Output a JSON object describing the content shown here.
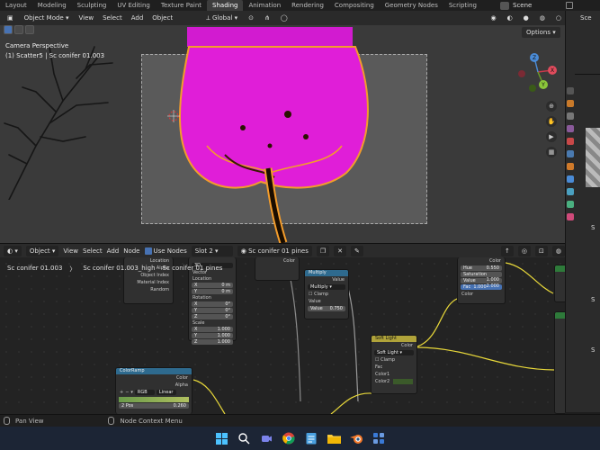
{
  "workspace_tabs": [
    "Layout",
    "Modeling",
    "Sculpting",
    "UV Editing",
    "Texture Paint",
    "Shading",
    "Animation",
    "Rendering",
    "Compositing",
    "Geometry Nodes",
    "Scripting"
  ],
  "active_tab_index": 5,
  "scene_name": "Scene",
  "viewport": {
    "mode": "Object Mode",
    "menus": [
      "View",
      "Select",
      "Add",
      "Object"
    ],
    "transform_orientation": "Global",
    "camera_label": "Camera Perspective",
    "object_label": "(1) Scatter5 | Sc conifer 01.003",
    "options_label": "Options",
    "gizmo_axes": [
      "X",
      "Y",
      "Z"
    ]
  },
  "right_panel": {
    "outliner_label": "Sce",
    "letters": [
      "S",
      "S",
      "S"
    ]
  },
  "node_editor": {
    "editor_type": "Object",
    "menus": [
      "View",
      "Select",
      "Add",
      "Node"
    ],
    "use_nodes_label": "Use Nodes",
    "slot": "Slot 2",
    "material": "Sc conifer 01 pines",
    "breadcrumb": [
      "Sc conifer 01.003",
      "Sc conifer 01.003_high",
      "Sc conifer 01 pines"
    ]
  },
  "nodes": {
    "object_info": {
      "outputs": [
        "Location",
        "Alpha",
        "Object Index",
        "Material Index",
        "Random"
      ]
    },
    "mapping": {
      "type": "3D",
      "vector_label": "Vector",
      "location_label": "Location",
      "rotation_label": "Rotation",
      "scale_label": "Scale",
      "location": [
        "0 m",
        "0 m",
        "0 m"
      ],
      "rotation": [
        "0°",
        "0°",
        "0°"
      ],
      "scale": [
        "1.000",
        "1.000",
        "1.000"
      ],
      "axes": [
        "X",
        "Y",
        "Z"
      ]
    },
    "color_out": {
      "label": "Color"
    },
    "multiply": {
      "title": "Multiply",
      "output": "Value",
      "operation": "Multiply",
      "clamp_label": "Clamp",
      "input_label": "Value",
      "value_label": "Value",
      "value": "0.750"
    },
    "hsv": {
      "output": "Color",
      "hue_label": "Hue",
      "hue": "0.550",
      "saturation_label": "Saturation",
      "saturation": "1.000",
      "value_label": "Value",
      "value": "2.000",
      "fac_label": "Fac",
      "fac": "1.000",
      "input": "Color"
    },
    "color_ramp": {
      "title": "ColorRamp",
      "outputs": [
        "Color",
        "Alpha"
      ],
      "mode": "RGB",
      "interpolation": "Linear",
      "pos_label": "Pos",
      "stop_index": "2",
      "pos_value": "0.260"
    },
    "soft_light": {
      "title": "Soft Light",
      "output": "Color",
      "blend": "Soft Light",
      "clamp_label": "Clamp",
      "fac_label": "Fac",
      "color1_label": "Color1",
      "color2_label": "Color2"
    }
  },
  "status_bar": {
    "left": "Pan View",
    "middle": "Node Context Menu"
  },
  "colors": {
    "accent_blue": "#4772b3",
    "foliage": "#e01ed8",
    "selection_outline": "#f39c2b",
    "link_yellow": "#e8d83a"
  }
}
